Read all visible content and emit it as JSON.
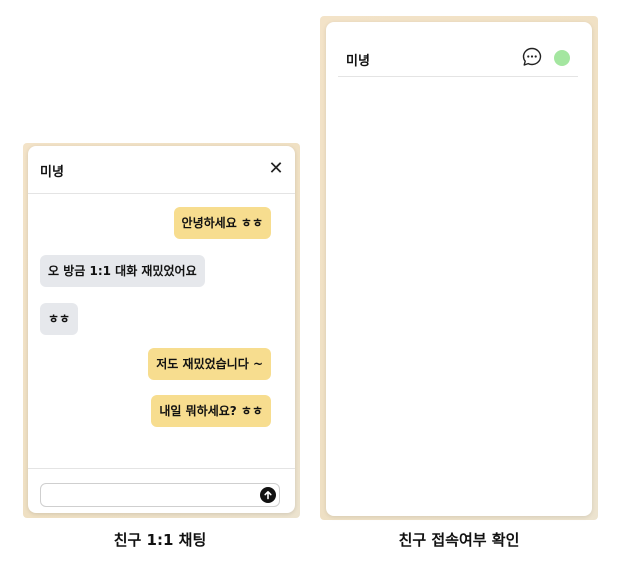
{
  "chat_window": {
    "title": "미녕",
    "close_symbol": "✕",
    "messages": [
      {
        "text": "안녕하세요 ㅎㅎ",
        "from": "me"
      },
      {
        "text": "오 방금 1:1 대화 재밌었어요",
        "from": "friend"
      },
      {
        "text": "ㅎㅎ",
        "from": "friend"
      },
      {
        "text": "저도 재밌었습니다 ~",
        "from": "me"
      },
      {
        "text": "내일 뭐하세요? ㅎㅎ",
        "from": "me"
      }
    ],
    "input_value": "",
    "send_icon": "arrow-up-circle-icon"
  },
  "status_window": {
    "title": "미녕",
    "chat_icon": "chat-bubble-icon",
    "online_color": "#a4e6a0"
  },
  "captions": {
    "left": "친구 1:1 채팅",
    "right": "친구 접속여부 확인"
  },
  "colors": {
    "my_bubble": "#f7dd8f",
    "friend_bubble": "#e6e8ec",
    "frame_background": "#f0e1c5"
  }
}
